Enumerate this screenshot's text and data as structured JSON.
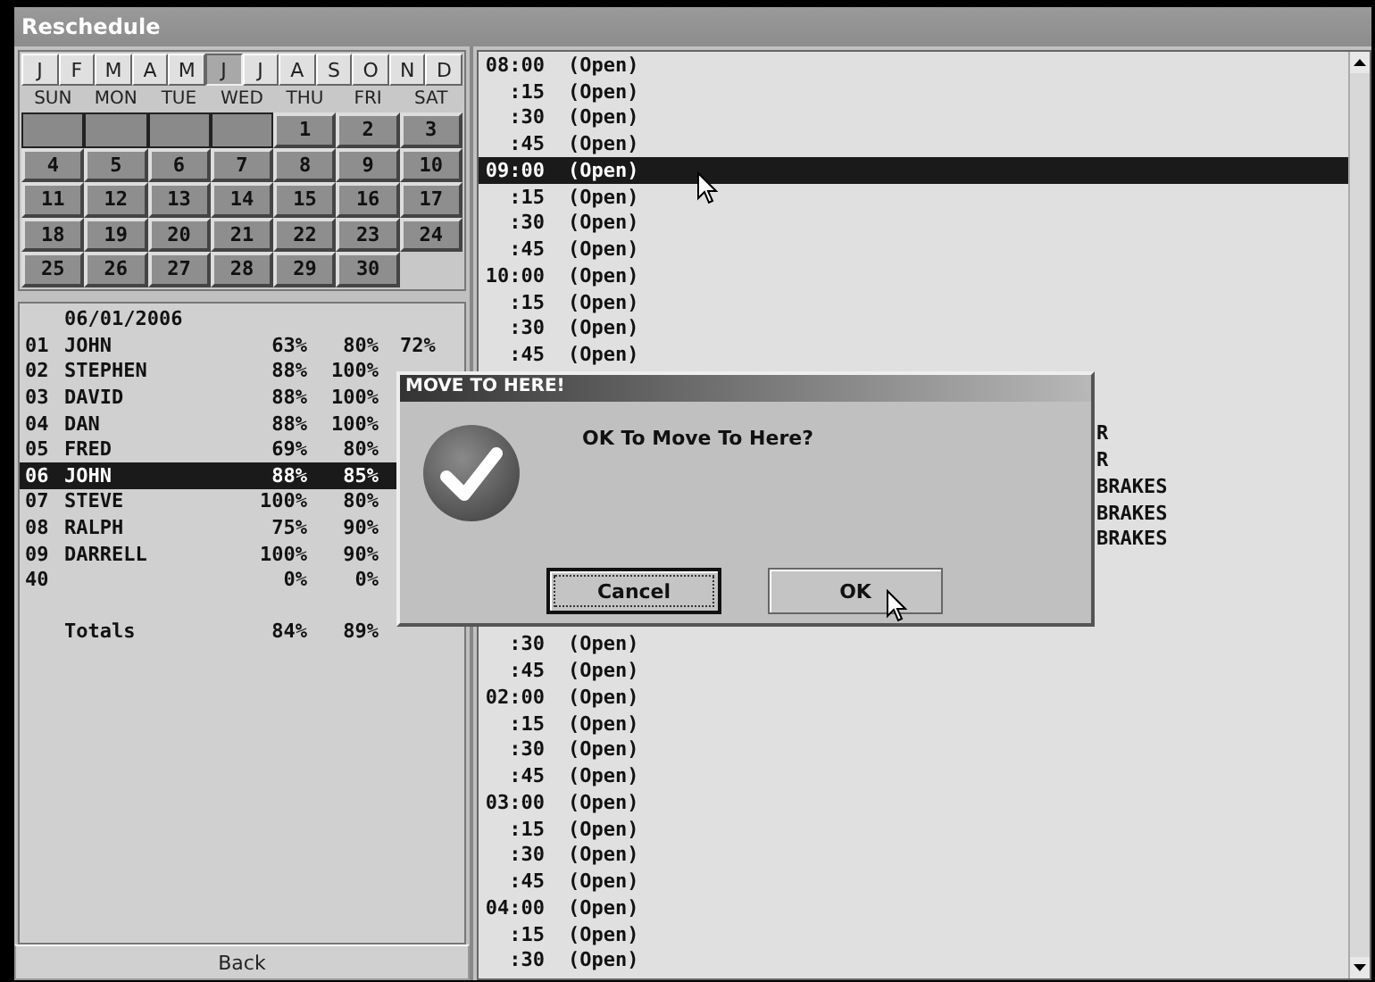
{
  "window": {
    "title": "Reschedule"
  },
  "calendar": {
    "months": [
      {
        "label": "J",
        "selected": false
      },
      {
        "label": "F",
        "selected": false
      },
      {
        "label": "M",
        "selected": false
      },
      {
        "label": "A",
        "selected": false
      },
      {
        "label": "M",
        "selected": false
      },
      {
        "label": "J",
        "selected": true
      },
      {
        "label": "J",
        "selected": false
      },
      {
        "label": "A",
        "selected": false
      },
      {
        "label": "S",
        "selected": false
      },
      {
        "label": "O",
        "selected": false
      },
      {
        "label": "N",
        "selected": false
      },
      {
        "label": "D",
        "selected": false
      }
    ],
    "weekdays": [
      "SUN",
      "MON",
      "TUE",
      "WED",
      "THU",
      "FRI",
      "SAT"
    ],
    "days": [
      {
        "kind": "blank"
      },
      {
        "kind": "blank"
      },
      {
        "kind": "blank"
      },
      {
        "kind": "blank"
      },
      {
        "kind": "day",
        "label": "1"
      },
      {
        "kind": "day",
        "label": "2"
      },
      {
        "kind": "day",
        "label": "3"
      },
      {
        "kind": "day",
        "label": "4"
      },
      {
        "kind": "day",
        "label": "5"
      },
      {
        "kind": "day",
        "label": "6"
      },
      {
        "kind": "day",
        "label": "7"
      },
      {
        "kind": "day",
        "label": "8"
      },
      {
        "kind": "day",
        "label": "9"
      },
      {
        "kind": "day",
        "label": "10"
      },
      {
        "kind": "day",
        "label": "11"
      },
      {
        "kind": "day",
        "label": "12"
      },
      {
        "kind": "day",
        "label": "13"
      },
      {
        "kind": "day",
        "label": "14"
      },
      {
        "kind": "day",
        "label": "15"
      },
      {
        "kind": "day",
        "label": "16"
      },
      {
        "kind": "day",
        "label": "17"
      },
      {
        "kind": "day",
        "label": "18"
      },
      {
        "kind": "day",
        "label": "19"
      },
      {
        "kind": "day",
        "label": "20"
      },
      {
        "kind": "day",
        "label": "21"
      },
      {
        "kind": "day",
        "label": "22"
      },
      {
        "kind": "day",
        "label": "23"
      },
      {
        "kind": "day",
        "label": "24"
      },
      {
        "kind": "day",
        "label": "25"
      },
      {
        "kind": "day",
        "label": "26"
      },
      {
        "kind": "day",
        "label": "27"
      },
      {
        "kind": "day",
        "label": "28"
      },
      {
        "kind": "day",
        "label": "29"
      },
      {
        "kind": "day",
        "label": "30"
      }
    ]
  },
  "staff": {
    "date": "06/01/2006",
    "rows": [
      {
        "number": "01",
        "name": "JOHN",
        "column_1": "63%",
        "column_2": "80%",
        "column_3": "72%",
        "selected": false
      },
      {
        "number": "02",
        "name": "STEPHEN",
        "column_1": "88%",
        "column_2": "100%",
        "selected": false
      },
      {
        "number": "03",
        "name": "DAVID",
        "column_1": "88%",
        "column_2": "100%",
        "selected": false
      },
      {
        "number": "04",
        "name": "DAN",
        "column_1": "88%",
        "column_2": "100%",
        "selected": false
      },
      {
        "number": "05",
        "name": "FRED",
        "column_1": "69%",
        "column_2": "80%",
        "selected": false
      },
      {
        "number": "06",
        "name": "JOHN",
        "column_1": "88%",
        "column_2": "85%",
        "selected": true
      },
      {
        "number": "07",
        "name": "STEVE",
        "column_1": "100%",
        "column_2": "80%",
        "selected": false
      },
      {
        "number": "08",
        "name": "RALPH",
        "column_1": "75%",
        "column_2": "90%",
        "selected": false
      },
      {
        "number": "09",
        "name": "DARRELL",
        "column_1": "100%",
        "column_2": "90%",
        "selected": false
      },
      {
        "number": "40",
        "name": "",
        "column_1": "0%",
        "column_2": "0%",
        "selected": false
      }
    ],
    "totals": {
      "label": "Totals",
      "column_1": "84%",
      "column_2": "89%"
    }
  },
  "back_button": "Back",
  "schedule": [
    {
      "kind": "slot",
      "time": "08:00",
      "text": "(Open)",
      "selected": false
    },
    {
      "kind": "slot",
      "time": ":15",
      "text": "(Open)",
      "selected": false
    },
    {
      "kind": "slot",
      "time": ":30",
      "text": "(Open)",
      "selected": false
    },
    {
      "kind": "slot",
      "time": ":45",
      "text": "(Open)",
      "selected": false
    },
    {
      "kind": "slot",
      "time": "09:00",
      "text": "(Open)",
      "selected": true
    },
    {
      "kind": "slot",
      "time": ":15",
      "text": "(Open)",
      "selected": false
    },
    {
      "kind": "slot",
      "time": ":30",
      "text": "(Open)",
      "selected": false
    },
    {
      "kind": "slot",
      "time": ":45",
      "text": "(Open)",
      "selected": false
    },
    {
      "kind": "slot",
      "time": "10:00",
      "text": "(Open)",
      "selected": false
    },
    {
      "kind": "slot",
      "time": ":15",
      "text": "(Open)",
      "selected": false
    },
    {
      "kind": "slot",
      "time": ":30",
      "text": "(Open)",
      "selected": false
    },
    {
      "kind": "slot",
      "time": ":45",
      "text": "(Open)",
      "selected": false
    },
    {
      "kind": "hidden"
    },
    {
      "kind": "hidden"
    },
    {
      "kind": "partial",
      "text": "R"
    },
    {
      "kind": "partial",
      "text": "R"
    },
    {
      "kind": "partial",
      "text": "BRAKES"
    },
    {
      "kind": "partial",
      "text": "BRAKES"
    },
    {
      "kind": "partial",
      "text": "BRAKES"
    },
    {
      "kind": "hidden"
    },
    {
      "kind": "hidden"
    },
    {
      "kind": "hidden"
    },
    {
      "kind": "slot",
      "time": ":30",
      "text": "(Open)",
      "selected": false
    },
    {
      "kind": "slot",
      "time": ":45",
      "text": "(Open)",
      "selected": false
    },
    {
      "kind": "slot",
      "time": "02:00",
      "text": "(Open)",
      "selected": false
    },
    {
      "kind": "slot",
      "time": ":15",
      "text": "(Open)",
      "selected": false
    },
    {
      "kind": "slot",
      "time": ":30",
      "text": "(Open)",
      "selected": false
    },
    {
      "kind": "slot",
      "time": ":45",
      "text": "(Open)",
      "selected": false
    },
    {
      "kind": "slot",
      "time": "03:00",
      "text": "(Open)",
      "selected": false
    },
    {
      "kind": "slot",
      "time": ":15",
      "text": "(Open)",
      "selected": false
    },
    {
      "kind": "slot",
      "time": ":30",
      "text": "(Open)",
      "selected": false
    },
    {
      "kind": "slot",
      "time": ":45",
      "text": "(Open)",
      "selected": false
    },
    {
      "kind": "slot",
      "time": "04:00",
      "text": "(Open)",
      "selected": false
    },
    {
      "kind": "slot",
      "time": ":15",
      "text": "(Open)",
      "selected": false
    },
    {
      "kind": "slot",
      "time": ":30",
      "text": "(Open)",
      "selected": false
    }
  ],
  "dialog": {
    "title": "MOVE TO HERE!",
    "message": "OK To Move To Here?",
    "buttons": [
      {
        "label": "Cancel",
        "focused": true
      },
      {
        "label": "OK",
        "focused": false
      }
    ]
  }
}
